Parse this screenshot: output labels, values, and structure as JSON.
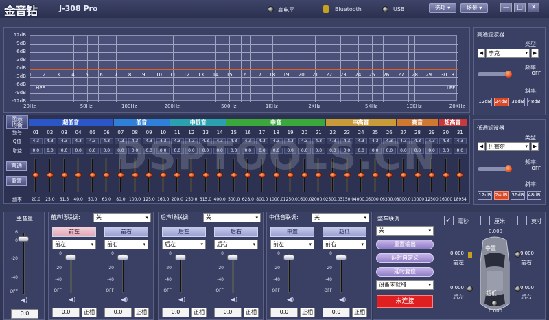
{
  "app": {
    "logo": "金音钻",
    "model": "J-308 Pro"
  },
  "status": {
    "high_level": "高电平",
    "bluetooth": "Bluetooth",
    "usb": "USB"
  },
  "menu": {
    "options": "选项",
    "scene": "场景"
  },
  "graph": {
    "y_labels": [
      "12dB",
      "9dB",
      "6dB",
      "3dB",
      "0dB",
      "-3dB",
      "-6dB",
      "-9dB",
      "-12dB"
    ],
    "x_labels": [
      "20Hz",
      "50Hz",
      "100Hz",
      "200Hz",
      "500Hz",
      "1KHz",
      "2KHz",
      "5KHz",
      "10KHz",
      "20KHz"
    ],
    "hpf": "HPF",
    "lpf": "LPF",
    "band_numbers": [
      "1",
      "2",
      "3",
      "4",
      "5",
      "6",
      "7",
      "8",
      "9",
      "10",
      "11",
      "12",
      "13",
      "14",
      "15",
      "16",
      "17",
      "18",
      "19",
      "20",
      "21",
      "22",
      "23",
      "24",
      "25",
      "26",
      "27",
      "28",
      "29",
      "30",
      "31"
    ],
    "curve_color": "#e06020"
  },
  "eq": {
    "graphic_eq_label": "图示\n均衡",
    "row_labels": {
      "band": "频号",
      "q": "Q值",
      "gain": "增益",
      "freq": "频率"
    },
    "buttons": {
      "bypass": "直通",
      "reset": "重置"
    },
    "categories": [
      {
        "label": "超低音",
        "color": "#2a56c8"
      },
      {
        "label": "低音",
        "color": "#2f80d8"
      },
      {
        "label": "中低音",
        "color": "#2aa0b0"
      },
      {
        "label": "中音",
        "color": "#3aa83a"
      },
      {
        "label": "中高音",
        "color": "#c89a38"
      },
      {
        "label": "高音",
        "color": "#d07830"
      },
      {
        "label": "超高音",
        "color": "#c83a3a"
      }
    ],
    "band_ids": [
      "01",
      "02",
      "03",
      "04",
      "05",
      "06",
      "07",
      "08",
      "09",
      "10",
      "11",
      "12",
      "13",
      "14",
      "15",
      "16",
      "17",
      "18",
      "19",
      "20",
      "21",
      "22",
      "23",
      "24",
      "25",
      "26",
      "27",
      "28",
      "29",
      "30",
      "31"
    ],
    "q_values": [
      "4.3",
      "4.3",
      "4.3",
      "4.3",
      "4.3",
      "4.3",
      "4.3",
      "4.3",
      "4.3",
      "4.3",
      "4.3",
      "4.3",
      "4.3",
      "4.3",
      "4.3",
      "4.3",
      "4.3",
      "4.3",
      "4.3",
      "4.3",
      "4.3",
      "4.3",
      "4.3",
      "4.3",
      "4.3",
      "4.3",
      "4.3",
      "4.3",
      "4.3",
      "4.3",
      "4.3"
    ],
    "gains": [
      "0.0",
      "0.0",
      "0.0",
      "0.0",
      "0.0",
      "0.0",
      "0.0",
      "0.0",
      "0.0",
      "0.0",
      "0.0",
      "0.0",
      "0.0",
      "0.0",
      "0.0",
      "0.0",
      "0.0",
      "0.0",
      "0.0",
      "0.0",
      "0.0",
      "0.0",
      "0.0",
      "0.0",
      "0.0",
      "0.0",
      "0.0",
      "0.0",
      "0.0",
      "0.0",
      "0.0"
    ],
    "freqs": [
      "20.0",
      "25.0",
      "31.5",
      "40.0",
      "50.0",
      "63.0",
      "80.0",
      "100.0",
      "125.0",
      "160.0",
      "200.0",
      "250.0",
      "315.0",
      "400.0",
      "500.0",
      "628.0",
      "800.0",
      "1000.0",
      "1250.0",
      "1600.0",
      "2000.0",
      "2500.0",
      "3150.0",
      "4000.0",
      "5000.0",
      "6300.0",
      "8000.0",
      "10000",
      "12500",
      "16000",
      "18954"
    ]
  },
  "watermark": "DSPTOOLS.CN",
  "hpf_panel": {
    "title": "高通滤波器",
    "type_label": "类型:",
    "type_value": "宁克",
    "freq_label": "频率:",
    "freq_value": "OFF",
    "slope_label": "斜率:",
    "slopes": [
      "12dB",
      "24dB",
      "36dB",
      "48dB"
    ],
    "active_slope": "24dB"
  },
  "lpf_panel": {
    "title": "低通滤波器",
    "type_label": "类型:",
    "type_value": "贝塞尔",
    "freq_label": "频率:",
    "freq_value": "OFF",
    "slope_label": "斜率:",
    "slopes": [
      "12dB",
      "24dB",
      "36dB",
      "48dB"
    ],
    "active_slope": "24dB"
  },
  "master": {
    "title": "主音量",
    "ticks": [
      "6",
      "0",
      "-20",
      "-40",
      "OFF"
    ],
    "value": "0.0"
  },
  "vol_ticks": [
    "0",
    "-20",
    "-40",
    "OFF"
  ],
  "front": {
    "title": "前声场联调:",
    "link": "关",
    "ch1": "前左",
    "ch2": "前右",
    "sel1": "前左",
    "sel2": "前右",
    "val1": "0.0",
    "val2": "0.0",
    "phase": "正相"
  },
  "rear": {
    "title": "后声场联调:",
    "link": "关",
    "ch1": "后左",
    "ch2": "后右",
    "sel1": "后左",
    "sel2": "后右",
    "val1": "0.0",
    "val2": "0.0",
    "phase": "正相"
  },
  "sub": {
    "title": "中低音联调:",
    "link": "关",
    "ch1": "中置",
    "ch2": "超低",
    "sel1": "前左",
    "sel2": "前右",
    "val1": "0.0",
    "val2": "0.0",
    "phase": "正相"
  },
  "car": {
    "title": "整车联调:",
    "link": "关",
    "reset_output": "重置输出",
    "delay_custom": "延时自定义",
    "delay_reset": "延时复位",
    "device_status": "设备未就绪",
    "connect": "未连接"
  },
  "units": {
    "ms": "毫秒",
    "cm": "厘米",
    "inch": "英寸"
  },
  "delays": {
    "center": "0.000",
    "front_left": "0.000",
    "front_right": "0.000",
    "rear_left": "0.000",
    "rear_right": "0.000",
    "sub": "0.000"
  },
  "seat_labels": {
    "center": "中置",
    "front_left": "前左",
    "front_right": "前右",
    "rear_left": "后左",
    "rear_right": "后右",
    "sub": "超低"
  }
}
